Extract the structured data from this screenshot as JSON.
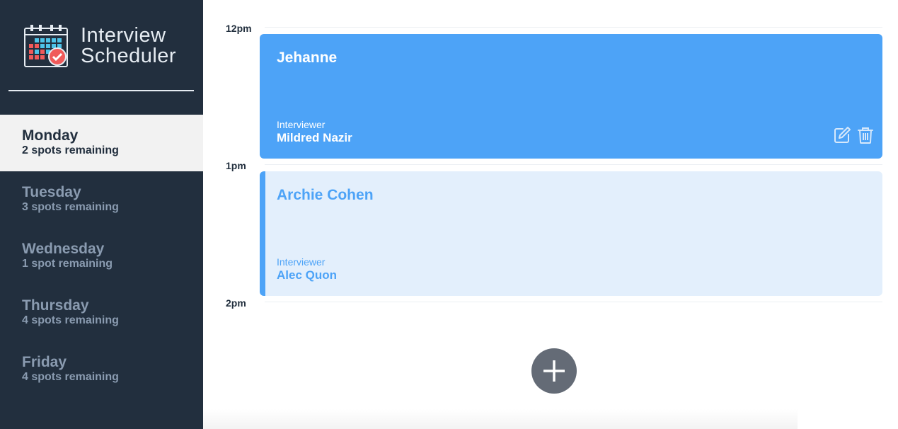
{
  "app": {
    "title_line1": "Interview",
    "title_line2": "Scheduler",
    "logo_icon": "calendar-check-icon"
  },
  "days": [
    {
      "name": "Monday",
      "spots": "2 spots remaining",
      "selected": true
    },
    {
      "name": "Tuesday",
      "spots": "3 spots remaining",
      "selected": false
    },
    {
      "name": "Wednesday",
      "spots": "1 spot remaining",
      "selected": false
    },
    {
      "name": "Thursday",
      "spots": "4 spots remaining",
      "selected": false
    },
    {
      "name": "Friday",
      "spots": "4 spots remaining",
      "selected": false
    }
  ],
  "times": [
    "12pm",
    "1pm",
    "2pm"
  ],
  "appointments": [
    {
      "student": "Jehanne",
      "interviewer_label": "Interviewer",
      "interviewer": "Mildred Nazir",
      "state": "active",
      "actions": [
        "edit-icon",
        "trash-icon"
      ]
    },
    {
      "student": "Archie Cohen",
      "interviewer_label": "Interviewer",
      "interviewer": "Alec Quon",
      "state": "inactive"
    }
  ],
  "add_button": {
    "icon": "plus-icon"
  },
  "colors": {
    "sidebar": "#222f3e",
    "selected_day_bg": "#f2f2f2",
    "accent": "#4da3f7",
    "appointment_inactive_bg": "#e3effc",
    "add_button": "#646b76"
  }
}
